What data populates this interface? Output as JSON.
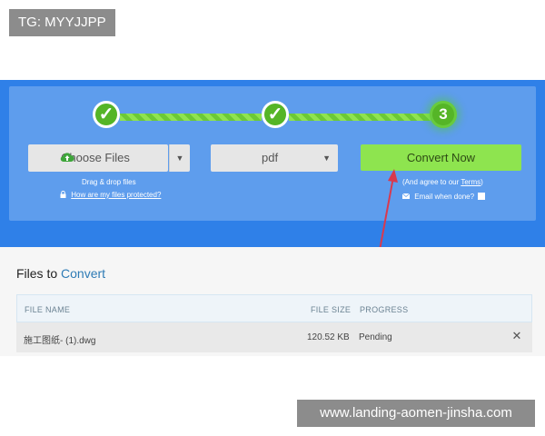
{
  "badges": {
    "top_left": "TG: MYYJJPP",
    "bottom_right": "www.landing-aomen-jinsha.com"
  },
  "steps": [
    {
      "label": "✓"
    },
    {
      "label": "✓"
    },
    {
      "label": "3"
    }
  ],
  "upload": {
    "choose_files": "Choose Files",
    "drag_drop": "Drag & drop files",
    "protected_link": "How are my files protected?"
  },
  "format": {
    "selected": "pdf"
  },
  "convert": {
    "button": "Convert Now",
    "agree_prefix": "(And agree to our ",
    "terms_link": "Terms",
    "agree_suffix": ")",
    "email_label": "Email when done?"
  },
  "files": {
    "title_prefix": "Files to ",
    "title_accent": "Convert",
    "columns": {
      "name": "FILE NAME",
      "size": "FILE SIZE",
      "progress": "PROGRESS"
    },
    "rows": [
      {
        "name": "施工图纸- (1).dwg",
        "size": "120.52 KB",
        "progress": "Pending"
      }
    ]
  },
  "colors": {
    "accent_green": "#8ee44f",
    "hero_blue": "#2f80e8",
    "link_blue": "#2e7bb5",
    "arrow_red": "#d9394e"
  }
}
